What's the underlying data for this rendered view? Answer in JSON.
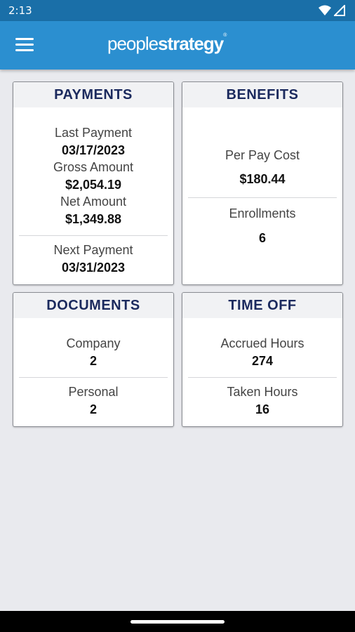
{
  "status": {
    "time": "2:13"
  },
  "brand": {
    "part1": "people",
    "part2": "strategy",
    "tm": "®"
  },
  "payments": {
    "title": "PAYMENTS",
    "last_payment_label": "Last Payment",
    "last_payment_value": "03/17/2023",
    "gross_label": "Gross Amount",
    "gross_value": "$2,054.19",
    "net_label": "Net Amount",
    "net_value": "$1,349.88",
    "next_payment_label": "Next Payment",
    "next_payment_value": "03/31/2023"
  },
  "benefits": {
    "title": "BENEFITS",
    "per_pay_label": "Per Pay Cost",
    "per_pay_value": "$180.44",
    "enrollments_label": "Enrollments",
    "enrollments_value": "6"
  },
  "documents": {
    "title": "DOCUMENTS",
    "company_label": "Company",
    "company_value": "2",
    "personal_label": "Personal",
    "personal_value": "2"
  },
  "timeoff": {
    "title": "TIME OFF",
    "accrued_label": "Accrued Hours",
    "accrued_value": "274",
    "taken_label": "Taken Hours",
    "taken_value": "16"
  },
  "icons": {
    "wifi": "wifi-icon",
    "signal": "signal-icon",
    "menu": "menu-icon"
  }
}
